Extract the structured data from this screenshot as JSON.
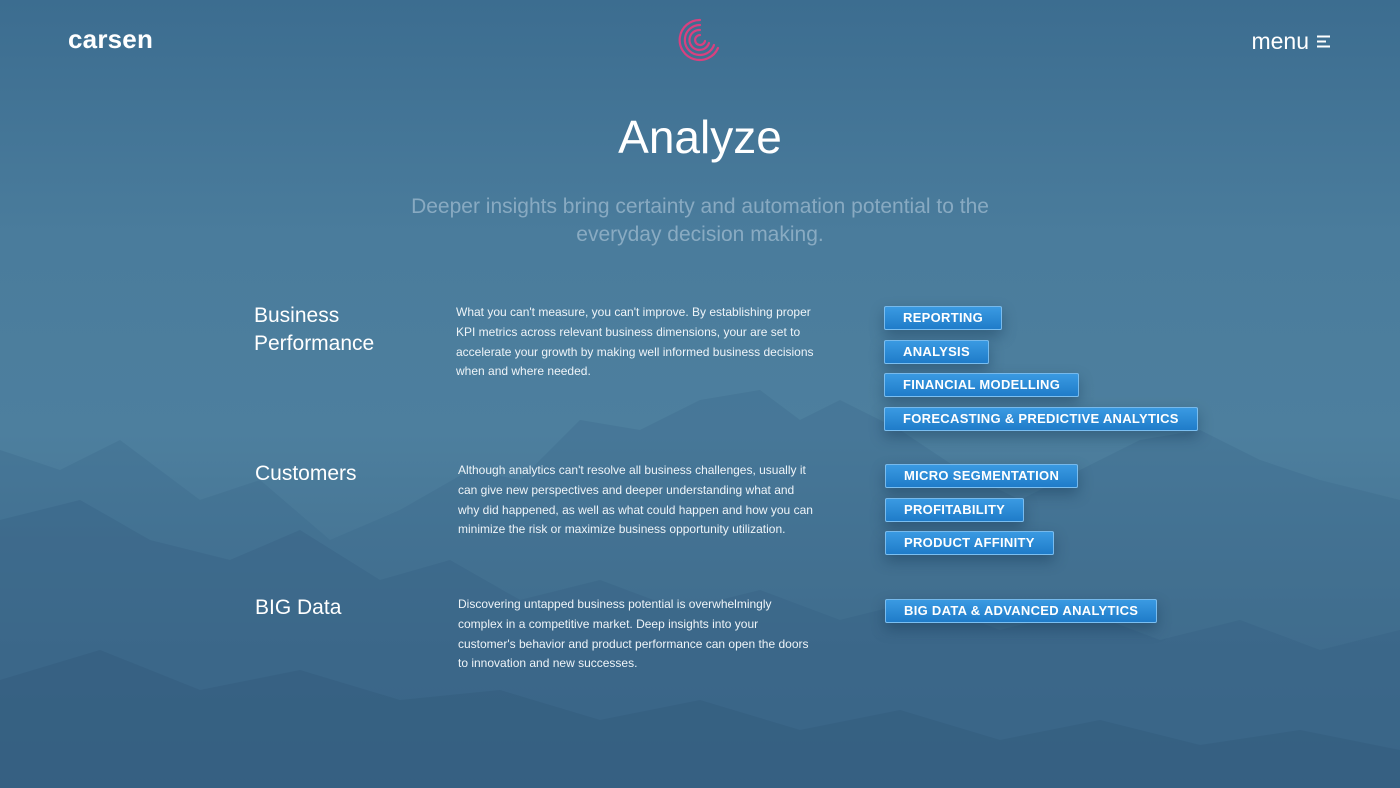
{
  "header": {
    "logo_text": "carsen",
    "brand_mark_icon": "concentric-c-logo-icon",
    "brand_color": "#d9407f",
    "menu_label": "menu",
    "menu_icon": "hamburger-icon"
  },
  "hero": {
    "title": "Analyze",
    "subtitle": "Deeper insights bring certainty and automation potential to the everyday decision making."
  },
  "sections": [
    {
      "title": "Business Performance",
      "description": "What you can't measure, you can't improve. By establishing proper KPI metrics across relevant business dimensions, your are set to accelerate your growth by making well informed business decisions when and where needed.",
      "tags": [
        "REPORTING",
        "ANALYSIS",
        "FINANCIAL MODELLING",
        "FORECASTING & PREDICTIVE ANALYTICS"
      ]
    },
    {
      "title": "Customers",
      "description": "Although analytics can't resolve all business challenges, usually it can give new perspectives and deeper understanding what and why did happened, as well as what could happen and how you can minimize the risk or maximize business opportunity utilization.",
      "tags": [
        "MICRO SEGMENTATION",
        "PROFITABILITY",
        "PRODUCT AFFINITY"
      ]
    },
    {
      "title": "BIG Data",
      "description": "Discovering untapped business potential is overwhelmingly complex in a competitive market. Deep insights into your customer's behavior and product performance can open the doors to innovation and new successes.",
      "tags": [
        "BIG DATA & ADVANCED ANALYTICS"
      ]
    }
  ],
  "colors": {
    "background": "#4a7c9c",
    "tag": "#2a8ad6"
  }
}
